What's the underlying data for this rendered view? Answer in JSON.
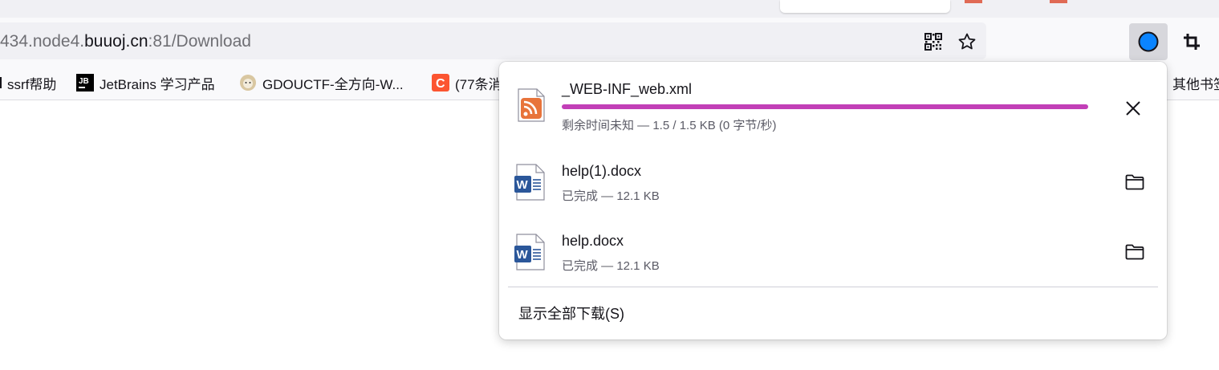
{
  "address_bar": {
    "url_prefix": "434.node4.",
    "url_domain": "buuoj.cn",
    "url_suffix": ":81/Download"
  },
  "bookmarks": [
    {
      "label": "ssrf帮助",
      "icon": "folder-icon"
    },
    {
      "label": "JetBrains 学习产品",
      "icon": "jetbrains-icon"
    },
    {
      "label": "GDOUCTF-全方向-W...",
      "icon": "sheep-avatar-icon"
    },
    {
      "label": "(77条消",
      "icon": "csdn-icon"
    },
    {
      "label": "其他书签",
      "icon": "folder-icon"
    }
  ],
  "downloads": [
    {
      "name": "_WEB-INF_web.xml",
      "status": "剩余时间未知 — 1.5 / 1.5 KB (0 字节/秒)",
      "icon": "rss-file-icon",
      "progress": 1.0,
      "action": "cancel"
    },
    {
      "name": "help(1).docx",
      "status": "已完成 — 12.1 KB",
      "icon": "word-doc-icon",
      "action": "open-folder"
    },
    {
      "name": "help.docx",
      "status": "已完成 — 12.1 KB",
      "icon": "word-doc-icon",
      "action": "open-folder"
    }
  ],
  "panel": {
    "show_all_label": "显示全部下载(S)"
  },
  "colors": {
    "progress": "#c23fb7",
    "word_blue": "#2b579a",
    "rss_orange": "#e8743b",
    "downloads_active": "#0a84ff"
  }
}
